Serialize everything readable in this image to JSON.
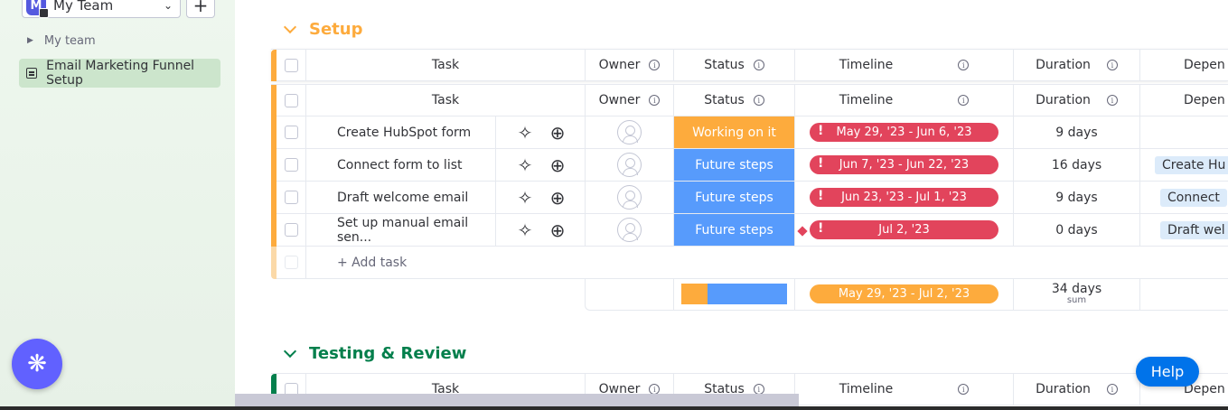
{
  "sidebar": {
    "team_name": "My Team",
    "team_initial": "M",
    "add_label": "+",
    "folder_label": "My team",
    "board_label": "Email Marketing Funnel Setup"
  },
  "columns": {
    "task": "Task",
    "owner": "Owner",
    "status": "Status",
    "timeline": "Timeline",
    "duration": "Duration",
    "dependency": "Depen"
  },
  "groups": [
    {
      "title": "Setup",
      "color": "#fdab3d"
    },
    {
      "title": "Testing & Review",
      "color": "#037f4c"
    }
  ],
  "tasks": [
    {
      "name": "Create HubSpot form",
      "status": "Working on it",
      "status_color": "#fdab3d",
      "timeline": "May 29, '23 - Jun 6, '23",
      "duration": "9 days",
      "dependency": ""
    },
    {
      "name": "Connect form to list",
      "status": "Future steps",
      "status_color": "#579bfc",
      "timeline": "Jun 7, '23 - Jun 22, '23",
      "duration": "16 days",
      "dependency": "Create Hu"
    },
    {
      "name": "Draft welcome email",
      "status": "Future steps",
      "status_color": "#579bfc",
      "timeline": "Jun 23, '23 - Jul 1, '23",
      "duration": "9 days",
      "dependency": "Connect"
    },
    {
      "name": "Set up manual email sen...",
      "status": "Future steps",
      "status_color": "#579bfc",
      "timeline": "Jul 2, '23",
      "duration": "0 days",
      "dependency": "Draft wel"
    }
  ],
  "add_task_label": "+ Add task",
  "summary": {
    "timeline": "May 29, '23 - Jul 2, '23",
    "duration": "34 days",
    "duration_caption": "sum",
    "status_fractions": {
      "working_on_it": 0.25,
      "future_steps": 0.75
    }
  },
  "help_label": "Help",
  "icons": {
    "info": "info-icon",
    "sparkle": "ai-sparkle-icon",
    "chat": "add-update-icon",
    "ai_fab": "ai-assistant-icon"
  }
}
